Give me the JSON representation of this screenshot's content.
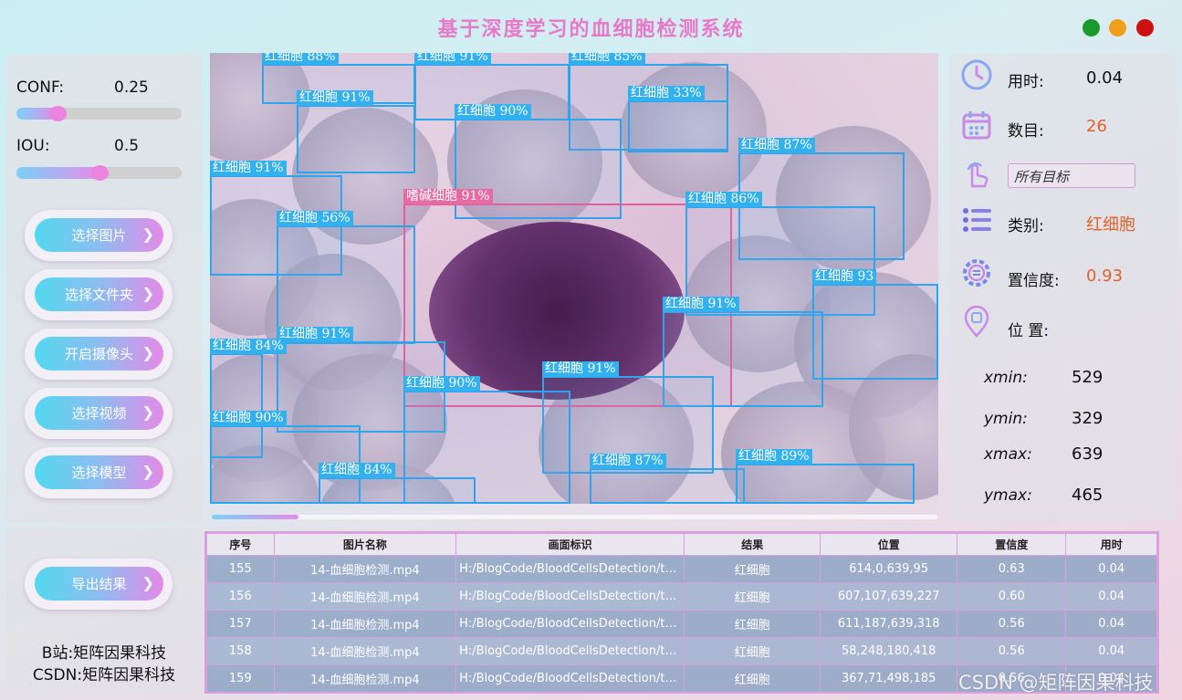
{
  "app": {
    "title": "基于深度学习的血细胞检测系统"
  },
  "params": {
    "conf_label": "CONF:",
    "conf_value": "0.25",
    "conf_level": 0.25,
    "iou_label": "IOU:",
    "iou_value": "0.5",
    "iou_level": 0.5
  },
  "buttons": {
    "select_image": "选择图片",
    "select_folder": "选择文件夹",
    "open_camera": "开启摄像头",
    "select_video": "选择视频",
    "select_model": "选择模型",
    "export_results": "导出结果"
  },
  "detections": [
    {
      "label": "红细胞 88%"
    },
    {
      "label": "红细胞 91%"
    },
    {
      "label": "红细胞 85%"
    },
    {
      "label": "红细胞 91%"
    },
    {
      "label": "红细胞 90%"
    },
    {
      "label": "红细胞 33%"
    },
    {
      "label": "红细胞 87%"
    },
    {
      "label": "红细胞 91%"
    },
    {
      "label": "嗜碱细胞 91%"
    },
    {
      "label": "红细胞 86%"
    },
    {
      "label": "红细胞 56%"
    },
    {
      "label": "红细胞 93"
    },
    {
      "label": "红细胞 91%"
    },
    {
      "label": "红细胞 91%"
    },
    {
      "label": "红细胞 84%"
    },
    {
      "label": "红细胞 91%"
    },
    {
      "label": "红细胞 90%"
    },
    {
      "label": "红细胞 90%"
    },
    {
      "label": "红细胞 87%"
    },
    {
      "label": "红细胞 89%"
    },
    {
      "label": "红细胞 84%"
    }
  ],
  "video_progress": 0.12,
  "info": {
    "time_label": "用时:",
    "time_value": "0.04",
    "count_label": "数目:",
    "count_value": "26",
    "target_select": "所有目标",
    "class_label": "类别:",
    "class_value": "红细胞",
    "conf_label": "置信度:",
    "conf_value": "0.93",
    "position_label": "位 置:",
    "xmin_label": "xmin:",
    "xmin_value": "529",
    "ymin_label": "ymin:",
    "ymin_value": "329",
    "xmax_label": "xmax:",
    "xmax_value": "639",
    "ymax_label": "ymax:",
    "ymax_value": "465"
  },
  "colors": {
    "accent": "#e0622a",
    "title": "#e879c8",
    "box": "#2ea4ec",
    "box_special": "#ea5a9a"
  },
  "credits": {
    "bilibili": "B站:矩阵因果科技",
    "csdn": "CSDN:矩阵因果科技"
  },
  "table": {
    "headers": [
      "序号",
      "图片名称",
      "画面标识",
      "结果",
      "位置",
      "置信度",
      "用时"
    ],
    "rows": [
      [
        "155",
        "14-血细胞检测.mp4",
        "H:/BlogCode/BloodCellsDetection/tes...",
        "红细胞",
        "614,0,639,95",
        "0.63",
        "0.04"
      ],
      [
        "156",
        "14-血细胞检测.mp4",
        "H:/BlogCode/BloodCellsDetection/tes...",
        "红细胞",
        "607,107,639,227",
        "0.60",
        "0.04"
      ],
      [
        "157",
        "14-血细胞检测.mp4",
        "H:/BlogCode/BloodCellsDetection/tes...",
        "红细胞",
        "611,187,639,318",
        "0.56",
        "0.04"
      ],
      [
        "158",
        "14-血细胞检测.mp4",
        "H:/BlogCode/BloodCellsDetection/tes...",
        "红细胞",
        "58,248,180,418",
        "0.56",
        "0.04"
      ],
      [
        "159",
        "14-血细胞检测.mp4",
        "H:/BlogCode/BloodCellsDetection/tes...",
        "红细胞",
        "367,71,498,185",
        "0.56",
        "0.04"
      ]
    ]
  },
  "watermark": "CSDN @矩阵因果科技"
}
